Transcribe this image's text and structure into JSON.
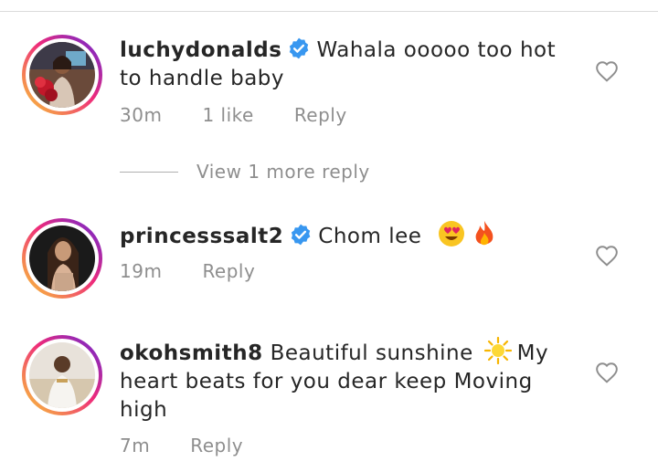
{
  "comments": [
    {
      "username": "luchydonalds",
      "verified": true,
      "text": "Wahala ooooo too hot to handle baby",
      "time": "30m",
      "likes": "1 like",
      "reply_label": "Reply"
    },
    {
      "username": "princesssalt2",
      "verified": true,
      "text": "Chom lee",
      "emojis": [
        "heart-eyes-emoji",
        "fire-emoji"
      ],
      "time": "19m",
      "reply_label": "Reply"
    },
    {
      "username": "okohsmith8",
      "verified": false,
      "text_before": "Beautiful sunshine",
      "text_after": "My heart beats for you dear keep Moving high",
      "emojis": [
        "sun-emoji"
      ],
      "time": "7m",
      "reply_label": "Reply"
    }
  ],
  "view_replies_label": "View 1 more reply",
  "colors": {
    "verified": "#3897f0",
    "meta": "#8e8e8e",
    "text": "#262626"
  }
}
